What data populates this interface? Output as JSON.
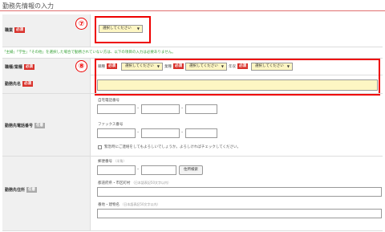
{
  "section": {
    "title": "勤務先情報の入力"
  },
  "badges": {
    "required": "必須",
    "optional": "任意"
  },
  "markers": {
    "m7": "⑦",
    "m8": "⑧"
  },
  "occupation": {
    "label": "職業",
    "select_value": "選択してください"
  },
  "notice": "「主婦」「学生」「その他」を選択した場合で勤務されていない方は、以下の項目の入力は必要ありません。",
  "job": {
    "label": "職種/業種",
    "fields": [
      {
        "label": "職種",
        "value": "選択してください"
      },
      {
        "label": "業種",
        "value": "選択してください"
      },
      {
        "label": "年収",
        "value": "選択してください"
      }
    ]
  },
  "company": {
    "label": "勤務先名"
  },
  "phone": {
    "label": "勤務先電話番号",
    "home_label": "自宅電話番号",
    "fax_label": "ファックス番号",
    "consent_text": "緊急時にご連絡をしてもよろしいでしょうか。よろしければチェックしてください。"
  },
  "address": {
    "label": "勤務先住所",
    "zip_label": "郵便番号",
    "zip_hint": "（半角）",
    "search_button": "住所検索",
    "pref_label": "都道府県・市区町村",
    "pref_hint": "（日本語表記50文字以内）",
    "street_label": "番地・建物名",
    "street_hint": "（日本語表記50文字以内）"
  },
  "colors": {
    "accent_red": "#d9322c",
    "highlight_yellow": "#fdf6c3",
    "notice_green": "#39a339"
  }
}
